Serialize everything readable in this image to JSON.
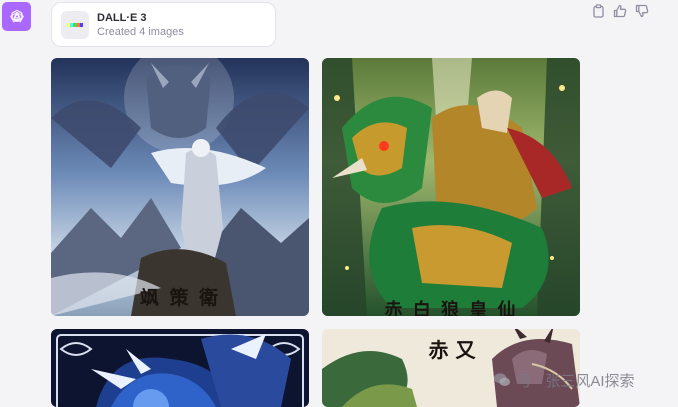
{
  "assistant": {
    "avatar_icon": "openai-logo-icon",
    "avatar_color": "#ab68ff"
  },
  "tool_card": {
    "title": "DALL·E 3",
    "subtitle": "Created 4 images",
    "icon": "dalle-color-bar-icon",
    "icon_colors": [
      "#ffff66",
      "#42ffff",
      "#51da4c",
      "#ff6e3c",
      "#3c46ff"
    ]
  },
  "message_actions": [
    {
      "name": "copy-icon",
      "label": "Copy"
    },
    {
      "name": "thumbs-up-icon",
      "label": "Good response"
    },
    {
      "name": "thumbs-down-icon",
      "label": "Bad response"
    }
  ],
  "images": [
    {
      "caption": "飒 策 衛"
    },
    {
      "caption": "赤 白 狼 皇 仙"
    },
    {
      "caption": ""
    },
    {
      "caption": "赤 又"
    }
  ],
  "watermark": {
    "text": "号 · 张三风AI探索",
    "icon": "wechat-icon"
  }
}
